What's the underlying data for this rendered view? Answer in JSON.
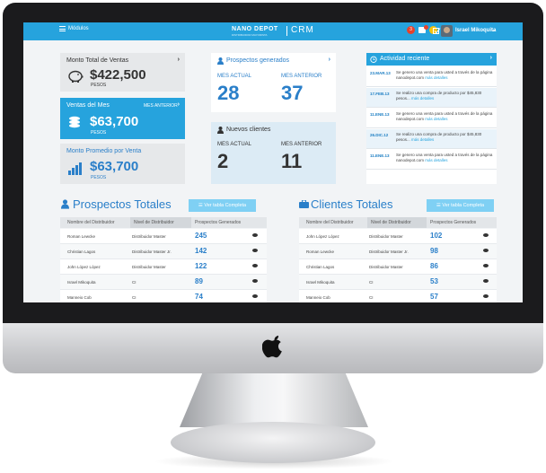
{
  "topbar": {
    "menu_label": "Módulos",
    "brand": "NANO DEPOT",
    "brand_sub": "DISTRIBUIDOR MAYORISTA",
    "app": "CRM",
    "notif_count": "3",
    "user_name": "Israel Mikoquita",
    "accent": "#26a3dd"
  },
  "cards": {
    "total": {
      "title": "Monto Total de Ventas",
      "value": "$422,500",
      "unit": "PESOS"
    },
    "month": {
      "title": "Ventas del Mes",
      "link": "MES ANTERIOR",
      "value": "$63,700",
      "unit": "PESOS"
    },
    "avg": {
      "title": "Monto Promedio por Venta",
      "value": "$63,700",
      "unit": "PESOS"
    },
    "prospects": {
      "title": "Prospectos generados",
      "cur_label": "MES ACTUAL",
      "prev_label": "MES ANTERIOR",
      "cur": "28",
      "prev": "37"
    },
    "clients": {
      "title": "Nuevos clientes",
      "cur_label": "MES ACTUAL",
      "prev_label": "MES ANTERIOR",
      "cur": "2",
      "prev": "11"
    }
  },
  "activity": {
    "title": "Actividad reciente",
    "items": [
      {
        "date": "23.MAR.13",
        "text": "Se genero una venta para usted a través de la página nanodepot.com",
        "link": "más detalles"
      },
      {
        "date": "17.FEB.13",
        "text": "Se realizo una compra de producto por $45,830 pesos...",
        "link": "más detalles"
      },
      {
        "date": "11.ENE.13",
        "text": "Se genero una venta para usted a través de la página nanodepot.com",
        "link": "más detalles"
      },
      {
        "date": "26.DIC.12",
        "text": "Se realizo una compra de producto por $45,830 pesos...",
        "link": "más detalles"
      },
      {
        "date": "11.ENE.13",
        "text": "Se genero una venta para usted a través de la página nanodepot.com",
        "link": "más detalles"
      }
    ]
  },
  "prospectos": {
    "title": "Prospectos Totales",
    "button": "Ver tabla Completa",
    "headers": [
      "Nombre del Distribuidor",
      "Nivel de Distribuidor",
      "Prospectos Generados"
    ],
    "rows": [
      {
        "name": "Roman Lewcke",
        "level": "Distribuidor Master",
        "count": "245"
      },
      {
        "name": "Christian Lagos",
        "level": "Distribuidor Master Jr.",
        "count": "142"
      },
      {
        "name": "John López López",
        "level": "Distribuidor Master",
        "count": "122"
      },
      {
        "name": "Israel Mikoquita",
        "level": "CI",
        "count": "89"
      },
      {
        "name": "Manneio Cob",
        "level": "CI",
        "count": "74"
      }
    ]
  },
  "clientes": {
    "title": "Clientes Totales",
    "button": "Ver tabla Completa",
    "headers": [
      "Nombre del Distribuidor",
      "Nivel de Distribuidor",
      "Prospectos Generados"
    ],
    "rows": [
      {
        "name": "John López López",
        "level": "Distribuidor Master",
        "count": "102"
      },
      {
        "name": "Roman Lewcke",
        "level": "Distribuidor Master Jr.",
        "count": "98"
      },
      {
        "name": "Christian Lagos",
        "level": "Distribuidor Master",
        "count": "86"
      },
      {
        "name": "Israel Mikoquita",
        "level": "CI",
        "count": "53"
      },
      {
        "name": "Manneio Cob",
        "level": "CI",
        "count": "57"
      }
    ]
  }
}
